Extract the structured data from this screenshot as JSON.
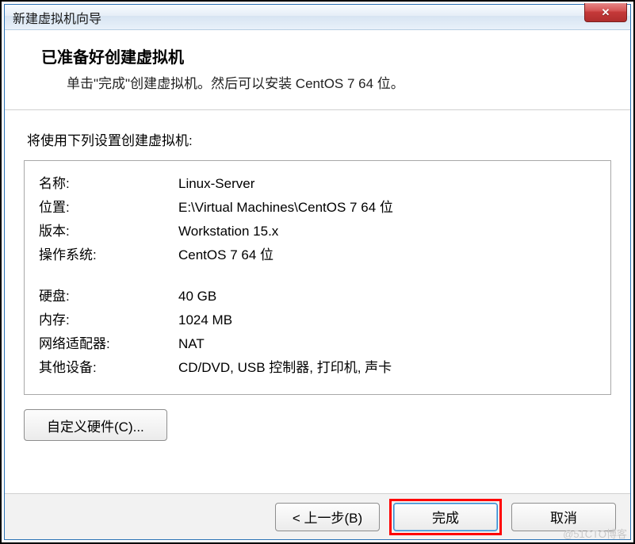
{
  "window": {
    "title": "新建虚拟机向导",
    "close_glyph": "✕"
  },
  "header": {
    "title": "已准备好创建虚拟机",
    "subtitle": "单击\"完成\"创建虚拟机。然后可以安装 CentOS 7 64 位。"
  },
  "content": {
    "prompt": "将使用下列设置创建虚拟机:"
  },
  "rows": {
    "name_label": "名称:",
    "name_value": "Linux-Server",
    "location_label": "位置:",
    "location_value": "E:\\Virtual Machines\\CentOS 7 64 位",
    "version_label": "版本:",
    "version_value": "Workstation 15.x",
    "os_label": "操作系统:",
    "os_value": "CentOS 7 64 位",
    "disk_label": "硬盘:",
    "disk_value": "40 GB",
    "memory_label": "内存:",
    "memory_value": "1024 MB",
    "network_label": "网络适配器:",
    "network_value": "NAT",
    "other_label": "其他设备:",
    "other_value": "CD/DVD, USB 控制器, 打印机, 声卡"
  },
  "buttons": {
    "customize": "自定义硬件(C)...",
    "back": "< 上一步(B)",
    "finish": "完成",
    "cancel": "取消"
  },
  "watermark": "@51CTO博客"
}
